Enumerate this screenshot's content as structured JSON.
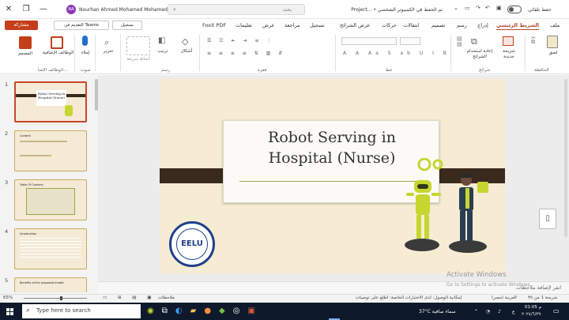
{
  "title_bar": {
    "autosave_label": "حفظ تلقائي",
    "search_placeholder": "بحث",
    "doc_title": "Project... • تم الحفظ في الكمبيوتر الشخصي",
    "user_name": "Nourhan Ahmed Mohamed Mohamed Ali",
    "user_initials": "NA"
  },
  "tabs": [
    "ملف",
    "الشريط الرئيسي",
    "إدراج",
    "رسم",
    "تصميم",
    "انتقالات",
    "حركات",
    "عرض الشرائح",
    "تسجيل",
    "مراجعة",
    "عرض",
    "تعليمات",
    "Foxit PDF"
  ],
  "tab_actions": {
    "record": "تسجيل",
    "present_teams": "التقديم في Teams",
    "share": "مشاركة"
  },
  "ribbon": {
    "groups": {
      "clipboard": "الحافظة",
      "slides": "شرائح",
      "font": "خط",
      "paragraph": "فقرة",
      "drawing": "رسم",
      "voice": "صوت",
      "addins": "الوظائف الإضا..."
    },
    "paste": "لصق",
    "new_slide": "شريحة جديدة",
    "reuse_slides": "إعادة استخدام الشرائح",
    "shapes": "أشكال",
    "arrange": "ترتيب",
    "quick_styles": "أنماط سريعة",
    "editing": "تحرير",
    "dictate": "إملاء",
    "addins_btn": "الوظائف الإضافية",
    "designer": "المصمم"
  },
  "thumbnails": [
    {
      "num": "1",
      "title": "Robot Serving in Hospital (Nurse)"
    },
    {
      "num": "2",
      "title": "Content"
    },
    {
      "num": "3",
      "title": "Table Of Content :"
    },
    {
      "num": "4",
      "title": "Introduction"
    },
    {
      "num": "5",
      "title": "Benefits of the proposed model:"
    }
  ],
  "slide": {
    "title_line1": "Robot Serving in",
    "title_line2": "Hospital (Nurse)",
    "logo_text": "EELU",
    "logo_ring": "THE EGYPTIAN E-LEARNING UNIVERSITY"
  },
  "notes_placeholder": "انقر لإضافة ملاحظات",
  "watermark": {
    "line1": "Activate Windows",
    "line2": "Go to Settings to activate Windows."
  },
  "status": {
    "slide_of": "شريحة 1 من ٣٥",
    "language": "العربية (مصر)",
    "accessibility": "إمكانية الوصول: لدى الاختيارات الخاصة: اطلع على توصيات",
    "notes": "ملاحظات",
    "zoom": "65%"
  },
  "taskbar": {
    "search_placeholder": "Type here to search",
    "weather": "37°C  سماء صافية",
    "time": "01:05 م",
    "date": "٢٠٢٤/٦/٢٩",
    "lang": "ع"
  },
  "colors": {
    "accent": "#b7472a",
    "share_button": "#c43e1c",
    "slide_band": "#3a2a1e",
    "robot_green": "#c6d62e",
    "taskbar": "#0e1a2b"
  }
}
